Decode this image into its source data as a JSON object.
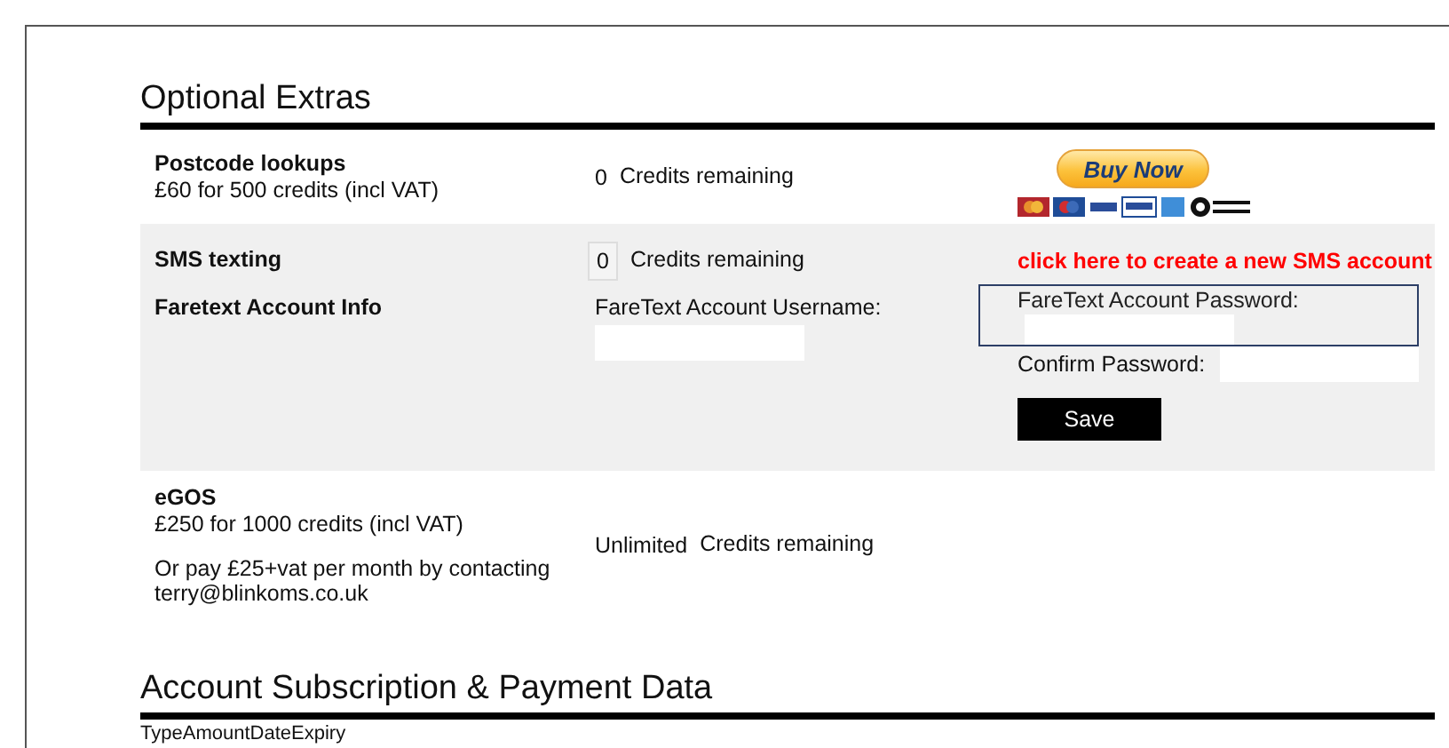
{
  "optional_extras": {
    "title": "Optional Extras",
    "products": [
      {
        "kind": "paid",
        "name": "Postcode lookups",
        "price": "£60 for 500 credits (incl VAT)",
        "credits": "0",
        "credits_label": "Credits remaining",
        "buy_button": "Buy Now"
      },
      {
        "kind": "sms",
        "name": "SMS texting",
        "credits": "0",
        "credits_label": "Credits remaining",
        "create_link": "click here to create a new SMS account",
        "account_info": {
          "label": "Faretext Account Info",
          "username_label": "FareText Account Username:",
          "password_label": "FareText Account Password:",
          "password_focused": true,
          "confirm_label": "Confirm Password:",
          "save_button": "Save"
        }
      },
      {
        "kind": "egos",
        "name": "eGOS",
        "price": "£250 for 1000 credits (incl VAT)",
        "note_lines": [
          "Or pay £25+vat per month by contacting",
          "terry@blinkoms.co.uk"
        ],
        "credits": "Unlimited",
        "credits_label": "Credits remaining"
      }
    ]
  },
  "subscription": {
    "title": "Account Subscription & Payment Data",
    "columns": [
      "Type",
      "Amount",
      "Date",
      "Expiry"
    ]
  }
}
